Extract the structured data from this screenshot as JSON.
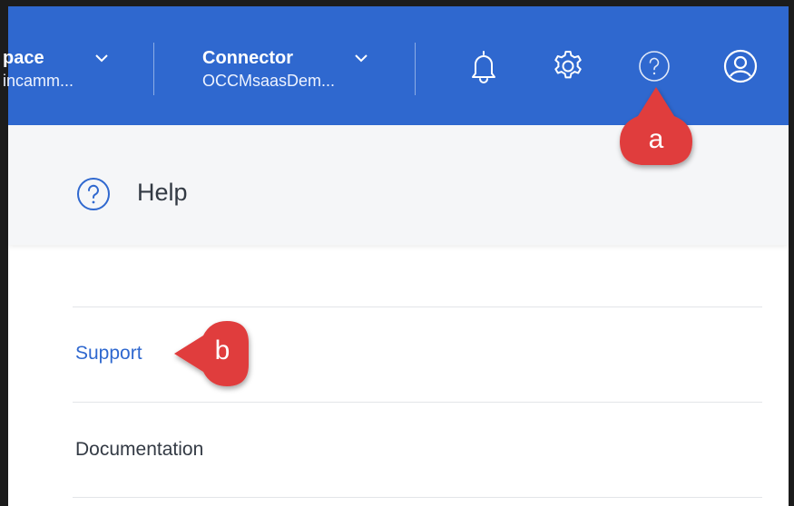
{
  "header": {
    "workspace": {
      "label": "pace",
      "value": "incamm..."
    },
    "connector": {
      "label": "Connector",
      "value": "OCCMsaasDem..."
    },
    "icons": {
      "notifications": "bell-icon",
      "settings": "gear-icon",
      "help": "help-icon",
      "account": "user-icon"
    },
    "colors": {
      "background": "#2f68cf",
      "text": "#ffffff"
    }
  },
  "help_panel": {
    "title": "Help",
    "items": [
      {
        "label": "Support"
      },
      {
        "label": "Documentation"
      }
    ]
  },
  "callouts": {
    "a": "a",
    "b": "b"
  },
  "colors": {
    "link": "#2f68cf",
    "callout": "#e03c3c"
  }
}
